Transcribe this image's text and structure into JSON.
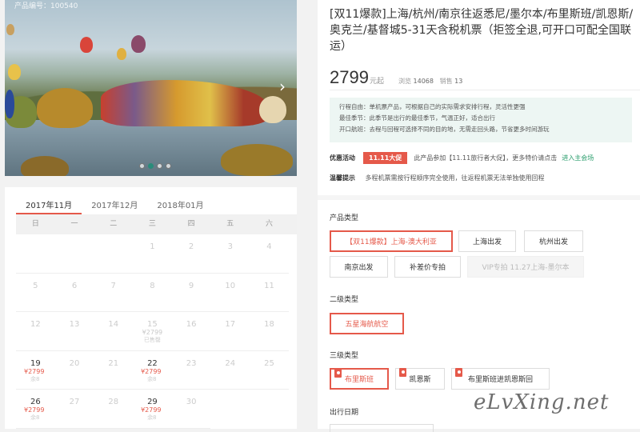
{
  "hero": {
    "caption": "产品编号：100540",
    "dots": [
      false,
      true,
      false,
      false
    ]
  },
  "calendar": {
    "months": [
      "2017年11月",
      "2017年12月",
      "2018年01月"
    ],
    "active_month": 0,
    "weekdays": [
      "日",
      "一",
      "二",
      "三",
      "四",
      "五",
      "六"
    ],
    "cells": [
      {
        "day": "",
        "price": "",
        "stock": ""
      },
      {
        "day": "",
        "price": "",
        "stock": ""
      },
      {
        "day": "",
        "price": "",
        "stock": ""
      },
      {
        "day": "1",
        "price": "",
        "stock": ""
      },
      {
        "day": "2",
        "price": "",
        "stock": ""
      },
      {
        "day": "3",
        "price": "",
        "stock": ""
      },
      {
        "day": "4",
        "price": "",
        "stock": ""
      },
      {
        "day": "5",
        "price": "",
        "stock": ""
      },
      {
        "day": "6",
        "price": "",
        "stock": ""
      },
      {
        "day": "7",
        "price": "",
        "stock": ""
      },
      {
        "day": "8",
        "price": "",
        "stock": ""
      },
      {
        "day": "9",
        "price": "",
        "stock": ""
      },
      {
        "day": "10",
        "price": "",
        "stock": ""
      },
      {
        "day": "11",
        "price": "",
        "stock": ""
      },
      {
        "day": "12",
        "price": "",
        "stock": ""
      },
      {
        "day": "13",
        "price": "",
        "stock": ""
      },
      {
        "day": "14",
        "price": "",
        "stock": ""
      },
      {
        "day": "15",
        "price": "¥2799",
        "stock": "已售罄",
        "gray": true
      },
      {
        "day": "16",
        "price": "",
        "stock": ""
      },
      {
        "day": "17",
        "price": "",
        "stock": ""
      },
      {
        "day": "18",
        "price": "",
        "stock": ""
      },
      {
        "day": "19",
        "price": "¥2799",
        "stock": "余8",
        "sale": true
      },
      {
        "day": "20",
        "price": "",
        "stock": ""
      },
      {
        "day": "21",
        "price": "",
        "stock": ""
      },
      {
        "day": "22",
        "price": "¥2799",
        "stock": "余8",
        "sale": true
      },
      {
        "day": "23",
        "price": "",
        "stock": ""
      },
      {
        "day": "24",
        "price": "",
        "stock": ""
      },
      {
        "day": "25",
        "price": "",
        "stock": ""
      },
      {
        "day": "26",
        "price": "¥2799",
        "stock": "余8",
        "sale": true
      },
      {
        "day": "27",
        "price": "",
        "stock": ""
      },
      {
        "day": "28",
        "price": "",
        "stock": ""
      },
      {
        "day": "29",
        "price": "¥2799",
        "stock": "余8",
        "sale": true
      },
      {
        "day": "30",
        "price": "",
        "stock": ""
      }
    ]
  },
  "product": {
    "title": "[双11爆款]上海/杭州/南京往返悉尼/墨尔本/布里斯班/凯恩斯/奥克兰/基督城5-31天含税机票（拒签全退,可开口可配全国联运）",
    "price": "2799",
    "price_unit": "元起",
    "views_label": "浏览",
    "views": "14068",
    "sales_label": "销售",
    "sales": "13",
    "info_lines": [
      "行程自由：单机票产品，可根据自己的实际需求安排行程，灵活性更强",
      "最佳季节：此季节是出行的最佳季节，气温正好，适合出行",
      "开口航班：去程与回程可选择不同的目的地，无需走回头路，节省更多时间游玩"
    ],
    "promo_label": "优惠活动",
    "promo_badge": "11.11大促",
    "promo_text": "此产品参加【11.11旅行者大促】，更多特价请点击",
    "promo_link": "进入主会场",
    "tip_label": "温馨提示",
    "tip_text": "多程机票需按行程顺序完全使用，往返程机票无法单独使用回程"
  },
  "options": {
    "type_label": "产品类型",
    "types": [
      "【双11爆款】上海-澳大利亚",
      "上海出发",
      "杭州出发",
      "南京出发",
      "补差价专拍",
      "VIP专拍 11.27上海-墨尔本"
    ],
    "level2_label": "二级类型",
    "level2": [
      "五星海航航空"
    ],
    "level3_label": "三级类型",
    "level3": [
      "布里斯班",
      "凯恩斯",
      "布里斯班进凯恩斯回"
    ],
    "date_label": "出行日期"
  },
  "watermark": "eLvXing.net"
}
